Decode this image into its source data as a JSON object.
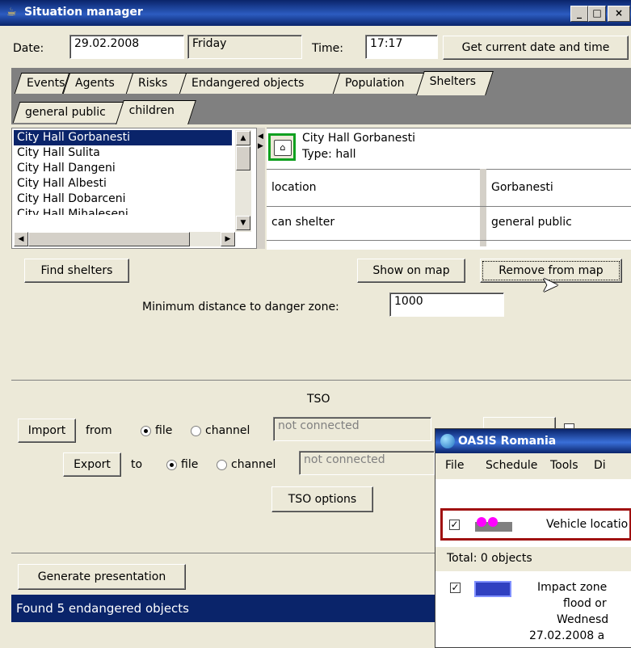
{
  "window": {
    "title": "Situation manager",
    "controls": [
      "_",
      "□",
      "×"
    ]
  },
  "datebar": {
    "date_label": "Date:",
    "date_value": "29.02.2008",
    "day_value": "Friday",
    "time_label": "Time:",
    "time_value": "17:17",
    "get_current_button": "Get current date and time"
  },
  "tabs": [
    "Events",
    "Agents",
    "Risks",
    "Endangered objects",
    "Population",
    "Shelters"
  ],
  "active_tab": "Shelters",
  "subtabs": [
    "general public",
    "children"
  ],
  "shelter_list": [
    "City Hall Gorbanesti",
    "City Hall Sulita",
    "City Hall Dangeni",
    "City Hall Albesti",
    "City Hall Dobarceni",
    "City Hall Mihaleseni"
  ],
  "selected_shelter": "City Hall Gorbanesti",
  "detail": {
    "name": "City Hall Gorbanesti",
    "type": "Type: hall",
    "rows": [
      {
        "key": "location",
        "value": "Gorbanesti"
      },
      {
        "key": "can shelter",
        "value": "general public"
      }
    ]
  },
  "shelter_actions": {
    "find": "Find shelters",
    "show_map": "Show on map",
    "remove_map": "Remove from map",
    "min_distance_label": "Minimum distance to danger zone:",
    "min_distance_value": "1000"
  },
  "tso": {
    "title": "TSO",
    "import_button": "Import",
    "from_label": "from",
    "export_button": "Export",
    "to_label": "to",
    "file_label": "file",
    "channel_label": "channel",
    "import_channel_placeholder": "not connected",
    "export_channel_placeholder": "not connected",
    "options_button": "TSO options"
  },
  "generate_button": "Generate presentation",
  "status_text": "Found 5 endangered objects",
  "oasis": {
    "title": "OASIS Romania",
    "menu": [
      "File",
      "Schedule",
      "Tools",
      "Di"
    ],
    "layer1_label": "Vehicle locatio",
    "total": "Total: 0 objects",
    "layer2_lines": [
      "Impact zone",
      "flood or",
      "Wednesd",
      "27.02.2008 a"
    ]
  },
  "colors": {
    "selection": "#0a246a",
    "title_gradient": "#2c5cc0",
    "layer_border": "#a01010",
    "shelter_icon_border": "#10a020"
  }
}
